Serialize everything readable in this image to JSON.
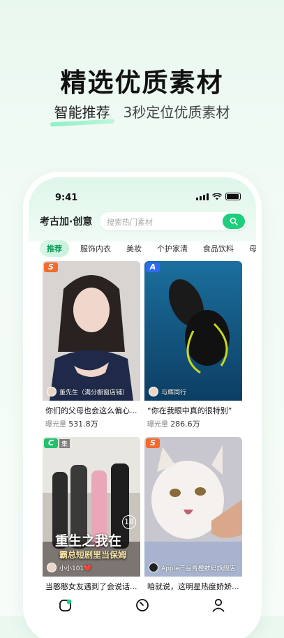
{
  "hero": {
    "title": "精选优质素材",
    "sub_highlight": "智能推荐",
    "sub_rest": "3秒定位优质素材"
  },
  "status_bar": {
    "time": "9:41"
  },
  "app": {
    "logo": "考古加·创意",
    "search_placeholder": "搜索热门素材"
  },
  "tabs": [
    "推荐",
    "服饰内衣",
    "美妆",
    "个护家清",
    "食品饮料",
    "母婴"
  ],
  "cards": [
    {
      "badge": "S",
      "author": "董先生（满分橱窗店铺）",
      "title": "你们的父母也会这么偏心...",
      "stat_label": "曝光量",
      "stat_value": "531.8万"
    },
    {
      "badge": "A",
      "author": "与辉同行",
      "title": "“你在我眼中真的很特别”",
      "stat_label": "曝光量",
      "stat_value": "286.6万"
    },
    {
      "badge": "C",
      "badge_tag": "集",
      "author": "小小101❤️",
      "overlay_title": "重生之我在",
      "overlay_sub": "霸总短剧里当保姆",
      "overlay_num": "18",
      "title": "当憨憨女友遇到了会说话...",
      "stat_label": "",
      "stat_value": ""
    },
    {
      "badge": "S",
      "author": "Apple产品青橙数码旗舰店",
      "title": "咱就说，这明星热度娇娇...",
      "stat_label": "",
      "stat_value": ""
    }
  ],
  "bottom_nav": [
    "home-icon",
    "discover-icon",
    "profile-icon"
  ],
  "colors": {
    "accent": "#1ccf7c",
    "badge_s": "#f26a2e",
    "badge_a": "#2e6bf2",
    "badge_c": "#26c06e"
  }
}
